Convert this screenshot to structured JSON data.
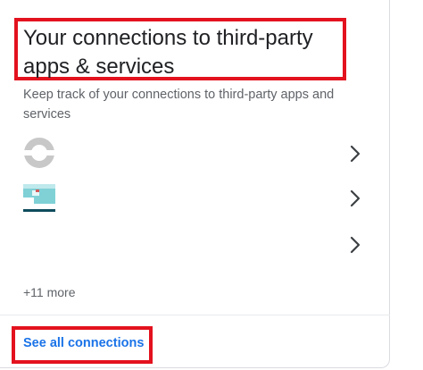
{
  "card": {
    "title": "Your connections to third-party apps & services",
    "subtitle": "Keep track of your connections to third-party apps and services",
    "more_count": "+11 more",
    "see_all_label": "See all connections"
  },
  "apps": [
    {
      "icon": "app-logo-gray-ring"
    },
    {
      "icon": "app-logo-teal-image"
    },
    {
      "icon": "blank-app-logo"
    }
  ],
  "colors": {
    "highlight": "#e3121e",
    "link": "#1a73e8",
    "title": "#202124",
    "secondary_text": "#5f6368"
  }
}
